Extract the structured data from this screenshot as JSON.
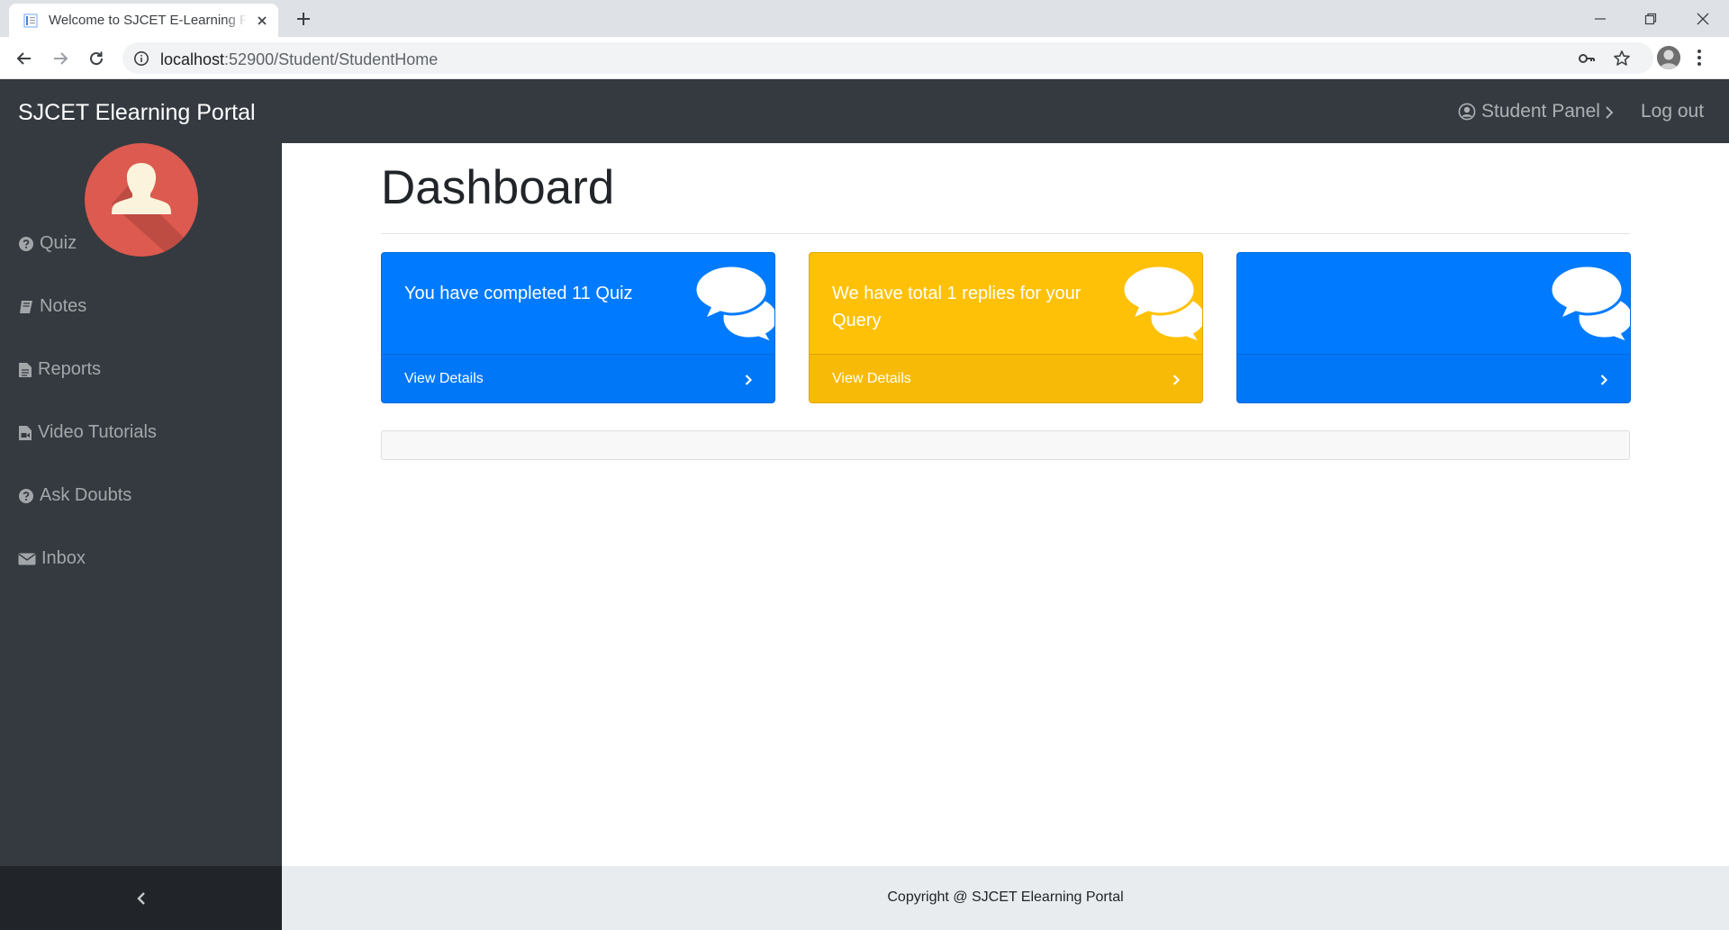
{
  "browser": {
    "tab_title": "Welcome to SJCET E-Learning Portal",
    "url_host": "localhost",
    "url_path": ":52900/Student/StudentHome",
    "icons": [
      "page-icon",
      "close-icon",
      "plus-icon",
      "minimize-icon",
      "restore-icon",
      "window-close-icon",
      "back-arrow-icon",
      "forward-arrow-icon",
      "reload-icon",
      "info-icon",
      "key-icon",
      "star-icon",
      "avatar-icon",
      "more-vert-icon"
    ]
  },
  "navbar": {
    "brand": "SJCET Elearning Portal",
    "panel_label": "Student Panel",
    "logout_label": "Log out",
    "icons": [
      "user-circle-icon",
      "chevron-right-icon"
    ]
  },
  "sidebar": {
    "items": [
      {
        "label": "Quiz",
        "icon": "question-circle-icon"
      },
      {
        "label": "Notes",
        "icon": "book-icon"
      },
      {
        "label": "Reports",
        "icon": "file-text-icon"
      },
      {
        "label": "Video Tutorials",
        "icon": "file-video-icon"
      },
      {
        "label": "Ask Doubts",
        "icon": "question-circle-icon"
      },
      {
        "label": "Inbox",
        "icon": "envelope-icon"
      }
    ],
    "toggle_icon": "chevron-left-icon"
  },
  "main": {
    "title": "Dashboard",
    "cards": [
      {
        "text": "You have completed 11 Quiz",
        "link": "View Details",
        "color": "#007bff",
        "icon": "comments-icon"
      },
      {
        "text": "We have total 1 replies for your Query",
        "link": "View Details",
        "color": "#ffc107",
        "icon": "comments-icon"
      },
      {
        "text": "",
        "link": "",
        "color": "#007bff",
        "icon": "comments-icon"
      }
    ]
  },
  "footer": {
    "copyright": "Copyright @ SJCET Elearning Portal"
  },
  "colors": {
    "navbar": "#343a40",
    "sidebar_toggle": "#212529",
    "primary": "#007bff",
    "warning": "#ffc107",
    "footer": "#e9ecef"
  }
}
